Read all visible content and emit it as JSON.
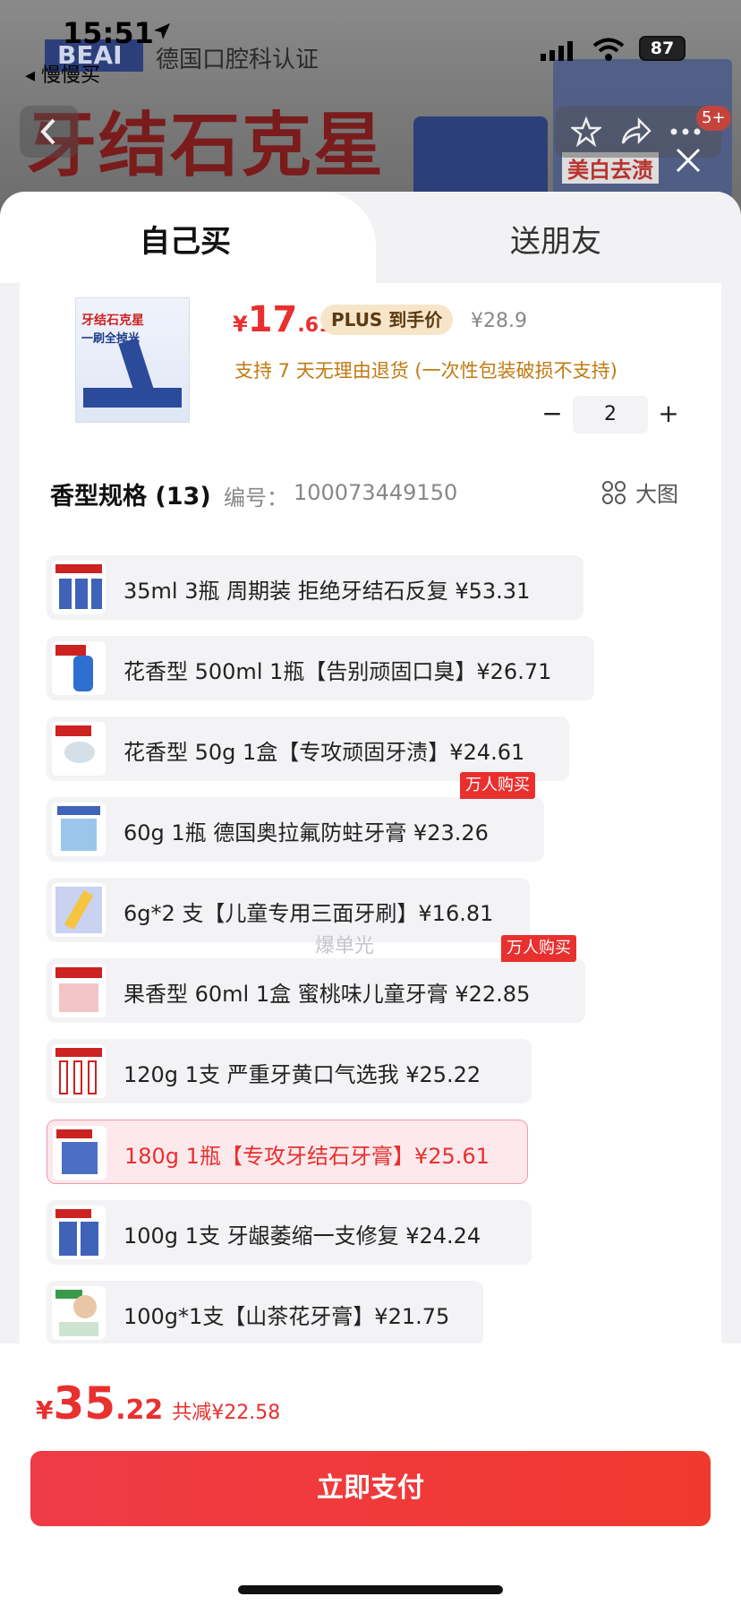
{
  "status_bar": {
    "time": "15:51",
    "battery": "87",
    "back_app": "慢慢买"
  },
  "background": {
    "brand": "BEAI",
    "certification": "德国口腔科认证",
    "headline": "牙结石克星",
    "badge": "美白去渍",
    "cart_count": "5+"
  },
  "tabs": [
    {
      "label": "自己买",
      "active": true
    },
    {
      "label": "送朋友",
      "active": false
    }
  ],
  "product": {
    "price_symbol": "¥",
    "price_int": "17",
    "price_dec": ".61",
    "plus_label": "PLUS 到手价",
    "original_price": "¥28.9",
    "return_policy": "支持 7 天无理由退货 (一次性包装破损不支持)",
    "image_title": "牙结石克星",
    "image_subtitle": "一刷全掉光"
  },
  "quantity": {
    "value": "2",
    "minus": "−",
    "plus": "+"
  },
  "spec": {
    "title": "香型规格 (13)",
    "code_label": "编号：",
    "code": "100073449150",
    "big_image_label": "大图"
  },
  "options": [
    {
      "label": "35ml 3瓶 周期装 拒绝牙结石反复   ¥53.31"
    },
    {
      "label": "花香型 500ml 1瓶【告别顽固口臭】¥26.71"
    },
    {
      "label": "花香型 50g 1盒【专攻顽固牙渍】¥24.61"
    },
    {
      "label": "60g 1瓶 德国奥拉氟防蛀牙膏   ¥23.26",
      "tag": "万人购买"
    },
    {
      "label": "6g*2 支【儿童专用三面牙刷】¥16.81"
    },
    {
      "label": "果香型 60ml 1盒 蜜桃味儿童牙膏   ¥22.85",
      "tag": "万人购买"
    },
    {
      "label": "120g 1支 严重牙黄口气选我   ¥25.22"
    },
    {
      "label": "180g 1瓶【专攻牙结石牙膏】¥25.61",
      "selected": true
    },
    {
      "label": "100g 1支 牙龈萎缩一支修复   ¥24.24"
    },
    {
      "label": "100g*1支【山茶花牙膏】¥21.75"
    }
  ],
  "watermark": "爆单光",
  "footer": {
    "total_symbol": "¥",
    "total_int": "35",
    "total_dec": ".22",
    "discount": "共减¥22.58",
    "pay_button": "立即支付"
  },
  "colors": {
    "accent": "#e8302e",
    "plus_badge_bg": "#f7e5c8",
    "policy": "#c07a12",
    "selected_bg": "#fde9ec"
  }
}
